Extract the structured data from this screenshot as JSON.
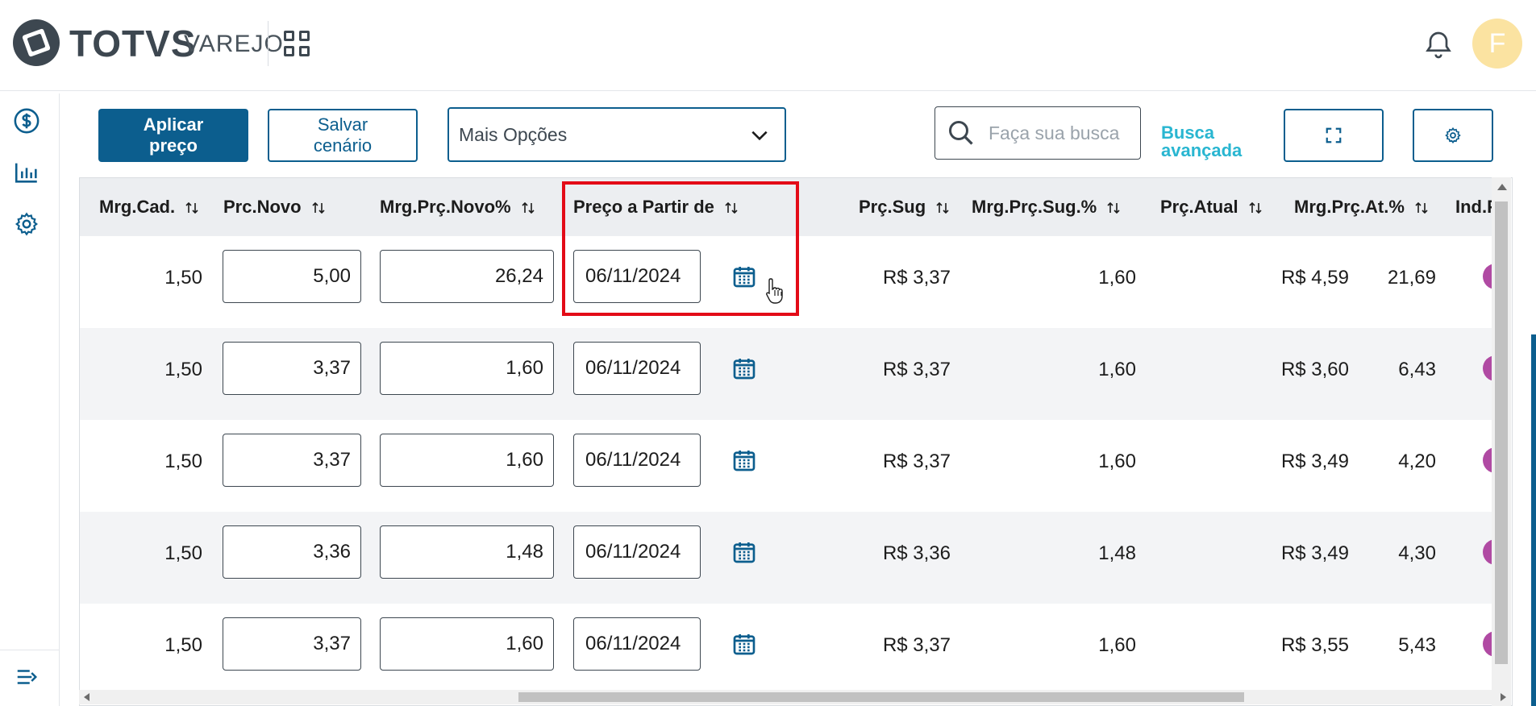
{
  "header": {
    "brand": "TOTVS",
    "brand_sub": "VAREJO",
    "avatar_initial": "F"
  },
  "toolbar": {
    "apply_label_line1": "Aplicar",
    "apply_label_line2": "preço",
    "save_label_line1": "Salvar",
    "save_label_line2": "cenário",
    "more_options": "Mais Opções",
    "search_placeholder": "Faça sua busca",
    "advanced_line1": "Busca",
    "advanced_line2": "avançada"
  },
  "table": {
    "columns": [
      "Mrg.Cad.",
      "Prc.Novo",
      "Mrg.Prç.Novo%",
      "Preço a Partir de",
      "Prç.Sug",
      "Mrg.Prç.Sug.%",
      "Prç.Atual",
      "Mrg.Prç.At.%",
      "Ind.F"
    ],
    "rows": [
      {
        "mrg_cad": "1,50",
        "prc_novo": "5,00",
        "mrg_novo": "26,24",
        "date": "06/11/2024",
        "prc_sug": "R$ 3,37",
        "mrg_sug": "1,60",
        "prc_atual": "R$ 4,59",
        "mrg_at": "21,69"
      },
      {
        "mrg_cad": "1,50",
        "prc_novo": "3,37",
        "mrg_novo": "1,60",
        "date": "06/11/2024",
        "prc_sug": "R$ 3,37",
        "mrg_sug": "1,60",
        "prc_atual": "R$ 3,60",
        "mrg_at": "6,43"
      },
      {
        "mrg_cad": "1,50",
        "prc_novo": "3,37",
        "mrg_novo": "1,60",
        "date": "06/11/2024",
        "prc_sug": "R$ 3,37",
        "mrg_sug": "1,60",
        "prc_atual": "R$ 3,49",
        "mrg_at": "4,20"
      },
      {
        "mrg_cad": "1,50",
        "prc_novo": "3,36",
        "mrg_novo": "1,48",
        "date": "06/11/2024",
        "prc_sug": "R$ 3,36",
        "mrg_sug": "1,48",
        "prc_atual": "R$ 3,49",
        "mrg_at": "4,30"
      },
      {
        "mrg_cad": "1,50",
        "prc_novo": "3,37",
        "mrg_novo": "1,60",
        "date": "06/11/2024",
        "prc_sug": "R$ 3,37",
        "mrg_sug": "1,60",
        "prc_atual": "R$ 3,55",
        "mrg_at": "5,43"
      }
    ]
  },
  "colors": {
    "primary": "#0c5e8e",
    "link": "#29b6d1",
    "highlight": "#e30b17",
    "status_dot": "#b04aa3",
    "avatar_bg": "#fbe3a1"
  },
  "icons": {
    "sidebar": [
      "dollar-circle-icon",
      "bar-chart-icon",
      "gear-icon",
      "collapse-menu-icon"
    ],
    "toolbar": [
      "chevron-down-icon",
      "search-icon",
      "fullscreen-icon",
      "gear-icon"
    ],
    "header": [
      "apps-grid-icon",
      "bell-icon"
    ],
    "row": "calendar-icon",
    "column": "sort-arrows-icon"
  }
}
